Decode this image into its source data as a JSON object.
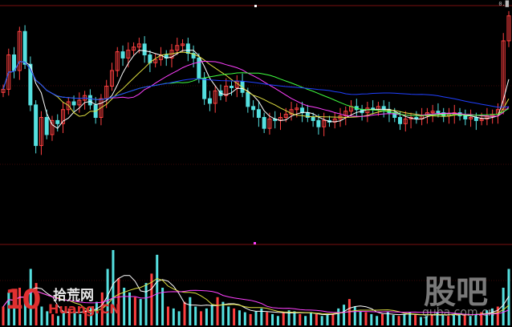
{
  "app": {
    "top_right_label": "0.█"
  },
  "watermarks": {
    "left_number": "10",
    "left_cn": "拾荒网",
    "left_url": "Huang.CN",
    "right_cn": "股吧",
    "right_url": "guba.com.cn"
  },
  "colors": {
    "up": "#ff4040",
    "down": "#55e0e0",
    "ma5": "#ffffff",
    "ma10": "#e0e040",
    "ma20": "#ff40ff",
    "ma30": "#40ff40",
    "ma60": "#2040ff",
    "grid": "#7a1010"
  },
  "chart_data": [
    {
      "type": "candlestick",
      "title": "",
      "xlabel": "",
      "ylabel": "",
      "grid": true,
      "ylim": [
        0,
        100
      ],
      "moving_averages": [
        "MA5",
        "MA10",
        "MA20",
        "MA30",
        "MA60"
      ],
      "closes": [
        48,
        70,
        60,
        85,
        64,
        38,
        12,
        30,
        19,
        28,
        26,
        35,
        40,
        38,
        41,
        44,
        38,
        30,
        42,
        50,
        60,
        72,
        68,
        73,
        75,
        77,
        70,
        65,
        67,
        70,
        68,
        73,
        76,
        77,
        71,
        68,
        55,
        42,
        39,
        47,
        44,
        50,
        49,
        53,
        46,
        37,
        35,
        30,
        23,
        29,
        28,
        30,
        32,
        35,
        36,
        33,
        30,
        28,
        24,
        28,
        27,
        29,
        31,
        34,
        37,
        35,
        33,
        36,
        35,
        37,
        35,
        33,
        30,
        26,
        29,
        30,
        29,
        31,
        33,
        34,
        33,
        31,
        32,
        33,
        31,
        29,
        30,
        28,
        29,
        31,
        32,
        35,
        79,
        95
      ]
    },
    {
      "type": "bar",
      "title": "",
      "xlabel": "",
      "ylabel": "",
      "series_name": "volume",
      "values": [
        20,
        35,
        25,
        40,
        30,
        60,
        45,
        20,
        15,
        12,
        10,
        15,
        18,
        14,
        12,
        16,
        20,
        25,
        35,
        60,
        80,
        50,
        40,
        35,
        30,
        28,
        45,
        55,
        75,
        40,
        20,
        18,
        15,
        25,
        30,
        20,
        15,
        18,
        22,
        30,
        25,
        20,
        18,
        16,
        14,
        12,
        15,
        18,
        14,
        12,
        10,
        14,
        16,
        15,
        12,
        10,
        14,
        12,
        10,
        11,
        12,
        18,
        22,
        28,
        20,
        15,
        14,
        12,
        10,
        12,
        14,
        11,
        10,
        12,
        14,
        11,
        9,
        10,
        12,
        14,
        11,
        10,
        12,
        13,
        11,
        10,
        12,
        14,
        16,
        18,
        20,
        40,
        60
      ]
    }
  ]
}
